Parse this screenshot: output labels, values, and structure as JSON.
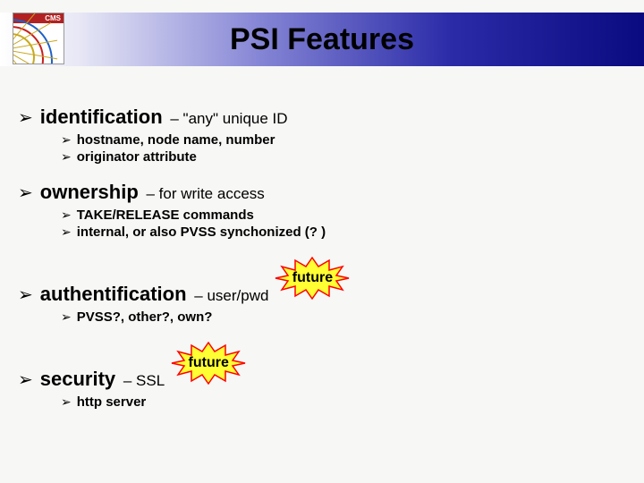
{
  "logo": {
    "tag": "CMS"
  },
  "title": "PSI Features",
  "bullets": [
    {
      "lead": "identification",
      "trail": " – \"any\" unique ID",
      "subs": [
        "hostname, node name, number",
        "originator attribute"
      ],
      "badge": null
    },
    {
      "lead": "ownership",
      "trail": " – for write access",
      "subs": [
        "TAKE/RELEASE commands",
        "internal, or also PVSS synchonized (? )"
      ],
      "badge": null
    },
    {
      "lead": "authentification",
      "trail": " – user/pwd",
      "subs": [
        "PVSS?, other?, own?"
      ],
      "badge": "future"
    },
    {
      "lead": "security",
      "trail": " – SSL",
      "subs": [
        "http server"
      ],
      "badge": "future"
    }
  ],
  "starburst": {
    "fill": "#ffff33",
    "stroke": "#ff0000"
  }
}
